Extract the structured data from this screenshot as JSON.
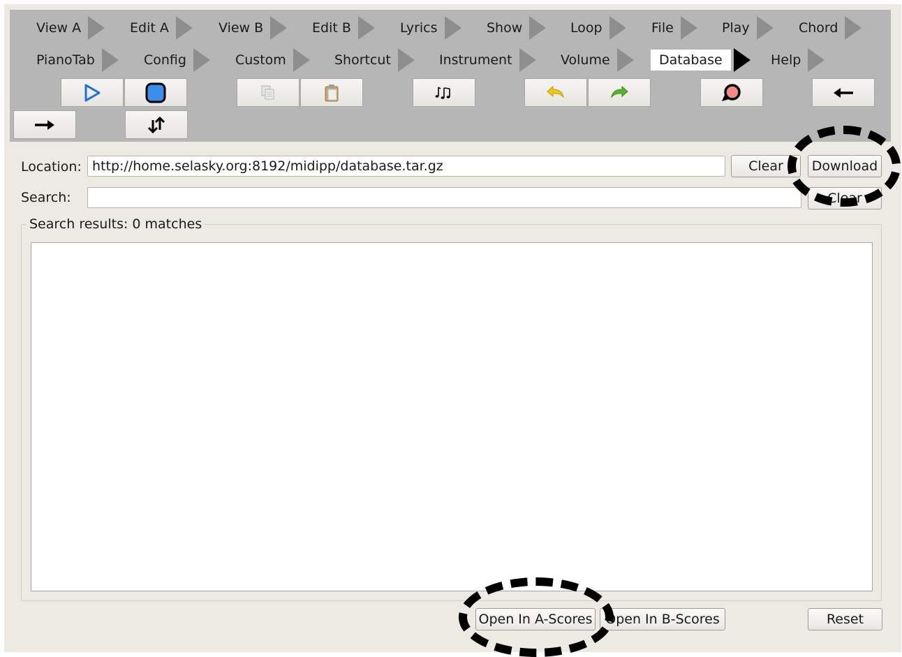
{
  "tabs_row1": [
    {
      "label": "View A"
    },
    {
      "label": "Edit A"
    },
    {
      "label": "View B"
    },
    {
      "label": "Edit B"
    },
    {
      "label": "Lyrics"
    },
    {
      "label": "Show"
    },
    {
      "label": "Loop"
    },
    {
      "label": "File"
    },
    {
      "label": "Play"
    },
    {
      "label": "Chord"
    }
  ],
  "tabs_row2": [
    {
      "label": "PianoTab"
    },
    {
      "label": "Config"
    },
    {
      "label": "Custom"
    },
    {
      "label": "Shortcut"
    },
    {
      "label": "Instrument"
    },
    {
      "label": "Volume"
    },
    {
      "label": "Database",
      "active": true
    },
    {
      "label": "Help"
    }
  ],
  "toolbar_buttons": [
    {
      "icon": "play-icon"
    },
    {
      "icon": "stop-icon"
    },
    {
      "icon": "copy-icon"
    },
    {
      "icon": "paste-icon"
    },
    {
      "icon": "music-notes-icon"
    },
    {
      "icon": "undo-icon"
    },
    {
      "icon": "redo-icon"
    },
    {
      "icon": "reload-icon"
    },
    {
      "icon": "arrow-left-icon"
    },
    {
      "icon": "arrow-right-icon"
    },
    {
      "icon": "swap-vertical-icon"
    }
  ],
  "location": {
    "label": "Location:",
    "value": "http://home.selasky.org:8192/midipp/database.tar.gz",
    "clear_label": "Clear",
    "download_label": "Download"
  },
  "search": {
    "label": "Search:",
    "value": "",
    "clear_label": "Clear"
  },
  "results": {
    "title": "Search results: 0 matches"
  },
  "footer": {
    "open_a_label": "Open In A-Scores",
    "open_b_label": "Open In B-Scores",
    "reset_label": "Reset"
  },
  "colors": {
    "toolbar_bg": "#b6b6b6",
    "window_bg": "#edeae4",
    "play_blue": "#1e6fd9",
    "stop_blue": "#3b8fe8",
    "undo_yellow": "#f0c419",
    "redo_green": "#5ab52c",
    "reload_pink": "#f28a8a"
  }
}
